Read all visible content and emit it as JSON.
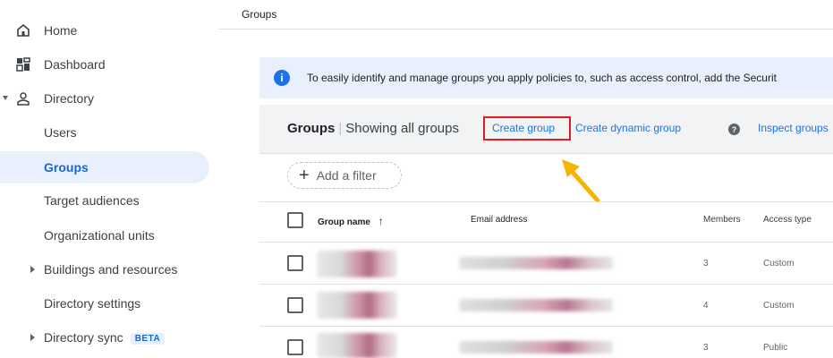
{
  "header": {
    "breadcrumb": "Groups"
  },
  "sidebar": {
    "items": [
      {
        "label": "Home",
        "icon": "home-icon"
      },
      {
        "label": "Dashboard",
        "icon": "dashboard-icon"
      },
      {
        "label": "Directory",
        "icon": "person-icon",
        "expanded": true
      },
      {
        "label": "Users"
      },
      {
        "label": "Groups",
        "active": true
      },
      {
        "label": "Target audiences"
      },
      {
        "label": "Organizational units"
      },
      {
        "label": "Buildings and resources",
        "collapsed": true
      },
      {
        "label": "Directory settings"
      },
      {
        "label": "Directory sync",
        "collapsed": true,
        "badge": "BETA"
      }
    ]
  },
  "banner": {
    "text": "To easily identify and manage groups you apply policies to, such as access control, add the Securit",
    "icon": "info-icon"
  },
  "toolbar": {
    "title": "Groups",
    "subtitle": "Showing all groups",
    "create_group": "Create group",
    "create_dynamic_group": "Create dynamic group",
    "inspect_groups": "Inspect groups",
    "help_icon": "help-icon"
  },
  "filter": {
    "label": "Add a filter",
    "plus": "+"
  },
  "table": {
    "columns": {
      "name": "Group name",
      "email": "Email address",
      "members": "Members",
      "access": "Access type"
    },
    "rows": [
      {
        "members": "3",
        "access": "Custom"
      },
      {
        "members": "4",
        "access": "Custom"
      },
      {
        "members": "3",
        "access": "Public"
      }
    ]
  },
  "colors": {
    "accent": "#1a73e8",
    "active_bg": "#e8f0fe",
    "highlight": "#e01c1c",
    "annotation_arrow": "#f4b400"
  }
}
